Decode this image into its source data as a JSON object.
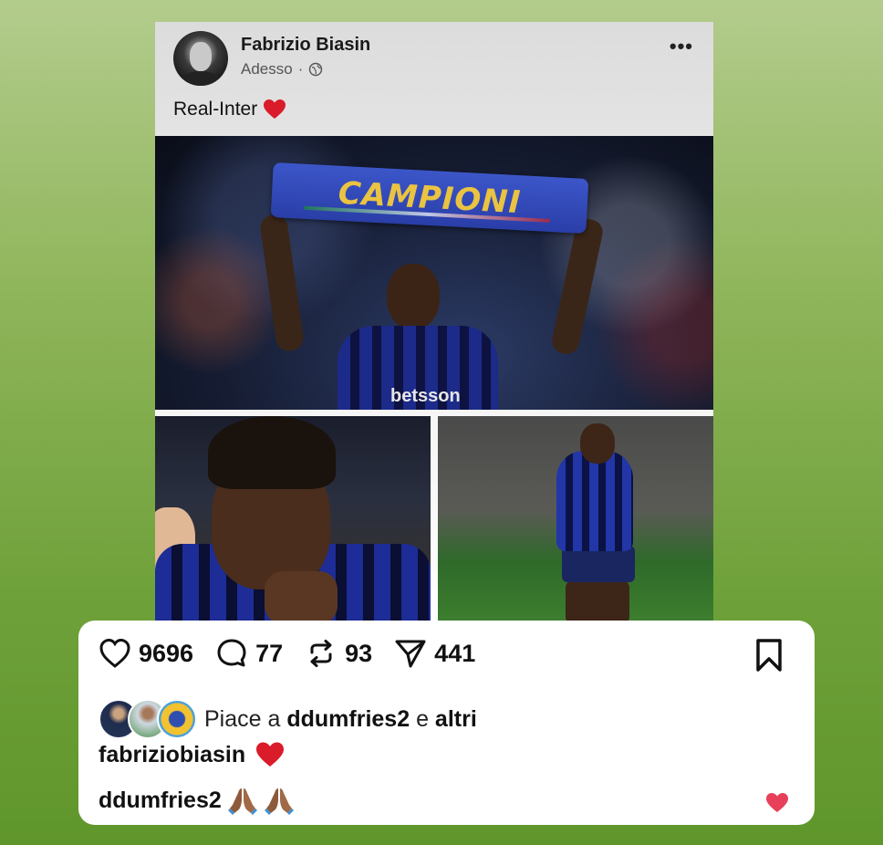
{
  "post": {
    "author_name": "Fabrizio Biasin",
    "time": "Adesso",
    "separator": "·",
    "visibility_icon": "globe-icon",
    "more_icon": "•••",
    "text": "Real-Inter",
    "text_emoji": "red-heart"
  },
  "images": {
    "main_banner_text": "CAMPIONI",
    "main_sponsor": "betsson"
  },
  "actions": {
    "likes": "9696",
    "comments": "77",
    "reposts": "93",
    "shares": "441"
  },
  "likes_line": {
    "prefix": "Piace a",
    "user": "ddumfries2",
    "conjunction": "e",
    "others": "altri"
  },
  "comments": [
    {
      "user": "fabriziobiasin",
      "emoji": "red-heart"
    },
    {
      "user": "ddumfries2",
      "emoji": "folded-hands x2"
    }
  ],
  "colors": {
    "heart": "#d91b2a",
    "like_heart_small": "#e8405a",
    "background_top": "#b3cc8d",
    "background_bottom": "#5f962b"
  }
}
